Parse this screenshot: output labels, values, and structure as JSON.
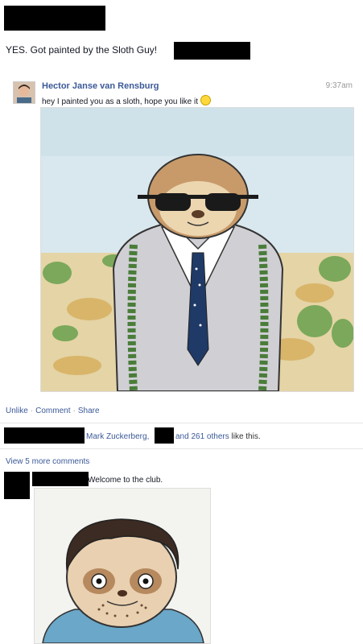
{
  "post": {
    "status_text": "YES. Got painted by the Sloth Guy!"
  },
  "comment": {
    "author": "Hector Janse van Rensburg",
    "time": "9:37am",
    "text": "hey I painted you as a sloth, hope you like it",
    "emoji_icon": "smiley-icon",
    "image_alt": "sloth-in-suit-painting"
  },
  "actions": {
    "unlike": "Unlike",
    "sep": "·",
    "comment": "Comment",
    "share": "Share"
  },
  "likes": {
    "name": "Mark Zuckerberg,",
    "others": "and 261 others",
    "suffix": "like this."
  },
  "more_comments": "View 5 more comments",
  "reply": {
    "text": "Welcome to the club.",
    "image_alt": "sloth-face-painting"
  },
  "colors": {
    "link": "#3b5998",
    "redaction": "#000000"
  }
}
